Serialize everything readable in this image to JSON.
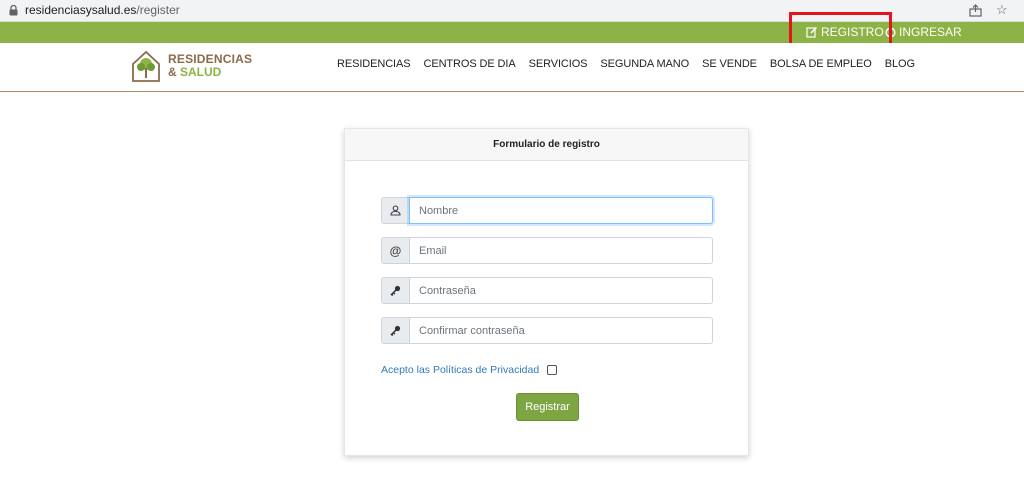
{
  "browser": {
    "url_domain": "residenciasysalud.es",
    "url_path": "/register"
  },
  "topbar": {
    "register_label": "REGISTRO",
    "login_label": "INGRESAR"
  },
  "logo": {
    "line1": "RESIDENCIAS",
    "amp": "&",
    "line2": "SALUD"
  },
  "nav": {
    "items": [
      "RESIDENCIAS",
      "CENTROS DE DIA",
      "SERVICIOS",
      "SEGUNDA MANO",
      "SE VENDE",
      "BOLSA DE EMPLEO",
      "BLOG"
    ]
  },
  "form": {
    "title": "Formulario de registro",
    "name_placeholder": "Nombre",
    "email_placeholder": "Email",
    "password_placeholder": "Contraseña",
    "confirm_placeholder": "Confirmar contraseña",
    "privacy_label": "Acepto las Políticas de Privacidad",
    "submit_label": "Registrar"
  },
  "colors": {
    "brand_green": "#8cb345",
    "brand_brown": "#8b6b4a",
    "highlight_red": "#e3161c"
  }
}
